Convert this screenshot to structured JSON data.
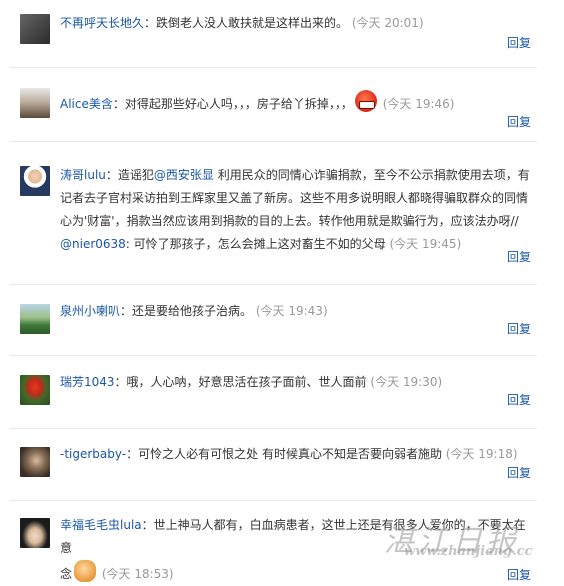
{
  "comments": [
    {
      "user": "不再呼天长地久",
      "text": "：跌倒老人没人敢扶就是这样出来的。",
      "time": "(今天 20:01)",
      "reply": "回复",
      "avatar_color": "#4a4a4a"
    },
    {
      "user": "Alice美含",
      "text": "：对得起那些好心人吗，，，房子给丫拆掉，，，",
      "emoji": "angry-emoji",
      "time": "(今天 19:46)",
      "reply": "回复",
      "avatar_color": "#7a6a5a"
    },
    {
      "user": "涛哥lulu",
      "text_a": "：造谣犯",
      "mention": "@西安张显",
      "text_b": " 利用民众的同情心诈骗捐款，至今不公示捐款使用去项，有记者去子官村采访拍到王辉家里又盖了新房。这些不用多说明眼人都晓得骗取群众的同情心为'财富'，捐款当然应该用到捐款的目的上去。转作他用就是欺骗行为，应该法办呀//",
      "mention2": "@nier0638",
      "text_c": ": 可怜了那孩子，怎么会摊上这对畜生不如的父母",
      "time": "(今天 19:45)",
      "reply": "回复",
      "avatar_color": "#2b4a6b"
    },
    {
      "user": "泉州小喇叭",
      "text": "：还是要给他孩子治病。",
      "time": "(今天 19:43)",
      "reply": "回复",
      "avatar_color": "#3f7a3a"
    },
    {
      "user": "瑞芳1043",
      "text": "：哦，人心呐，好意思活在孩子面前、世人面前",
      "time": "(今天 19:30)",
      "reply": "回复",
      "avatar_color": "#c02a1a"
    },
    {
      "user": "-tigerbaby-",
      "text": "：可怜之人必有可恨之处 有时候真心不知是否要向弱者施助",
      "time": "(今天 19:18)",
      "reply": "回复",
      "avatar_color": "#5a4a3a"
    },
    {
      "user": "幸福毛毛虫lula",
      "text": "：世上神马人都有，白血病患者，这世上还是有很多人爱你的，不要太在意",
      "text_2": "念",
      "emoji": "fist-emoji",
      "time": "(今天 18:53)",
      "reply": "回复",
      "avatar_color": "#222222"
    }
  ],
  "watermark": {
    "cn": "湛江日报",
    "url": "www.zhanjiang.cc"
  }
}
